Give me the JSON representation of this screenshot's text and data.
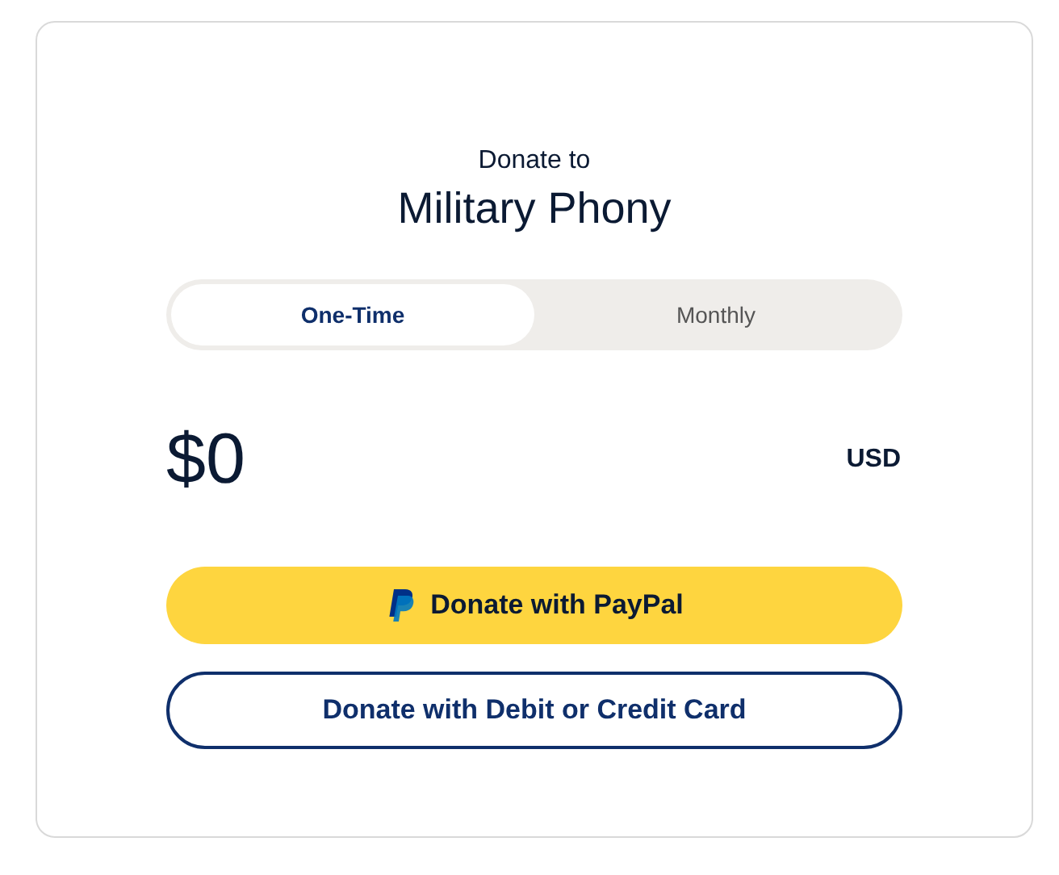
{
  "header": {
    "subtitle": "Donate to",
    "title": "Military Phony"
  },
  "tabs": [
    {
      "label": "One-Time",
      "selected": true
    },
    {
      "label": "Monthly",
      "selected": false
    }
  ],
  "amount": {
    "value": "$0",
    "currency": "USD"
  },
  "buttons": [
    {
      "kind": "paypal",
      "label": "Donate with PayPal"
    },
    {
      "kind": "card",
      "label": "Donate with Debit or Credit Card"
    }
  ]
}
